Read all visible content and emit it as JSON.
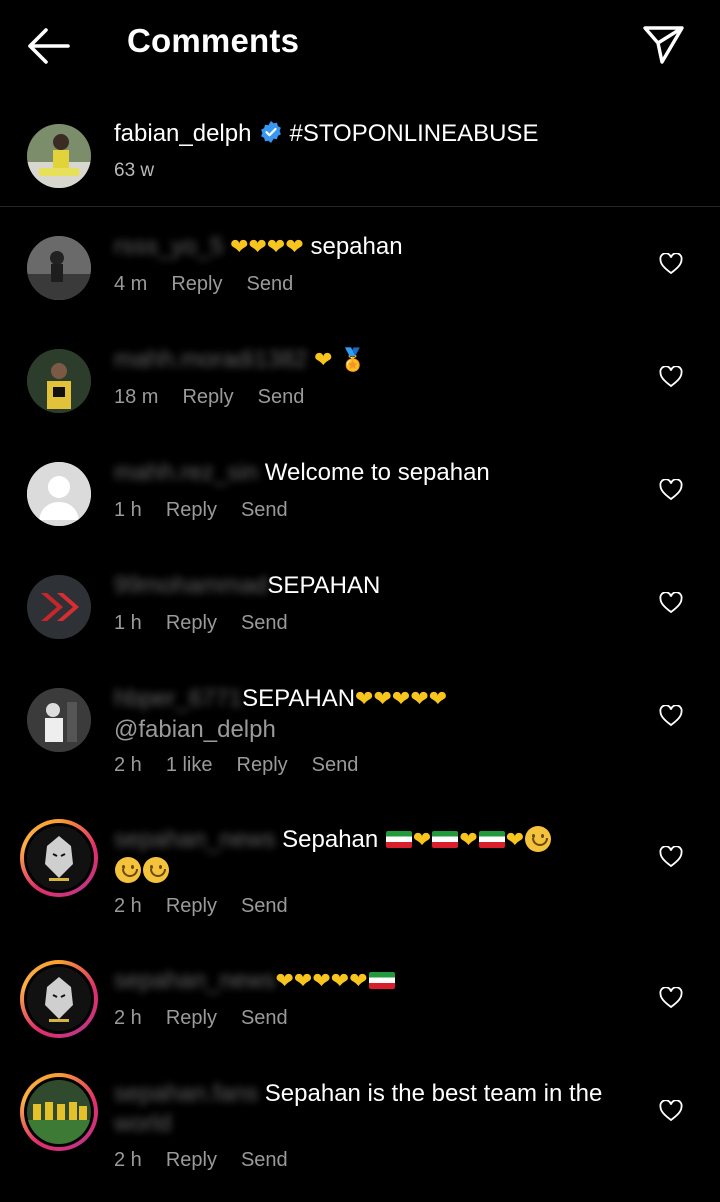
{
  "header": {
    "title": "Comments",
    "back_icon": "arrow-left-icon",
    "share_icon": "paper-plane-icon"
  },
  "post": {
    "username": "fabian_delph",
    "caption": "#STOPONLINEABUSE",
    "time": "63 w",
    "verified_color": "#3897f0"
  },
  "comments": [
    {
      "user": "rsss_yo_5",
      "text": "sepahan",
      "time": "4 m",
      "likes": "",
      "reply": "Reply",
      "send": "Send"
    },
    {
      "user": "mahh.moradi1382",
      "text": "",
      "time": "18 m",
      "likes": "",
      "reply": "Reply",
      "send": "Send"
    },
    {
      "user": "mahh.rez_sin",
      "text": "Welcome to sepahan",
      "time": "1 h",
      "likes": "",
      "reply": "Reply",
      "send": "Send"
    },
    {
      "user": "99mohammad",
      "text": "SEPAHAN",
      "time": "1 h",
      "likes": "",
      "reply": "Reply",
      "send": "Send"
    },
    {
      "user": "hbper_6771",
      "text": "SEPAHAN",
      "text2": "@fabian_delph",
      "time": "2 h",
      "likes": "1 like",
      "reply": "Reply",
      "send": "Send"
    },
    {
      "user": "sepahan_news",
      "text": "Sepahan",
      "time": "2 h",
      "likes": "",
      "reply": "Reply",
      "send": "Send"
    },
    {
      "user": "sepahan_news",
      "text": "",
      "time": "2 h",
      "likes": "",
      "reply": "Reply",
      "send": "Send"
    },
    {
      "user": "sepahan.fans",
      "text": "Sepahan is the best team in the",
      "text2": "world",
      "time": "2 h",
      "likes": "",
      "reply": "Reply",
      "send": "Send"
    }
  ],
  "colors": {
    "background": "#000000",
    "muted": "#9a9a9a",
    "heart": "#f7c51e"
  }
}
